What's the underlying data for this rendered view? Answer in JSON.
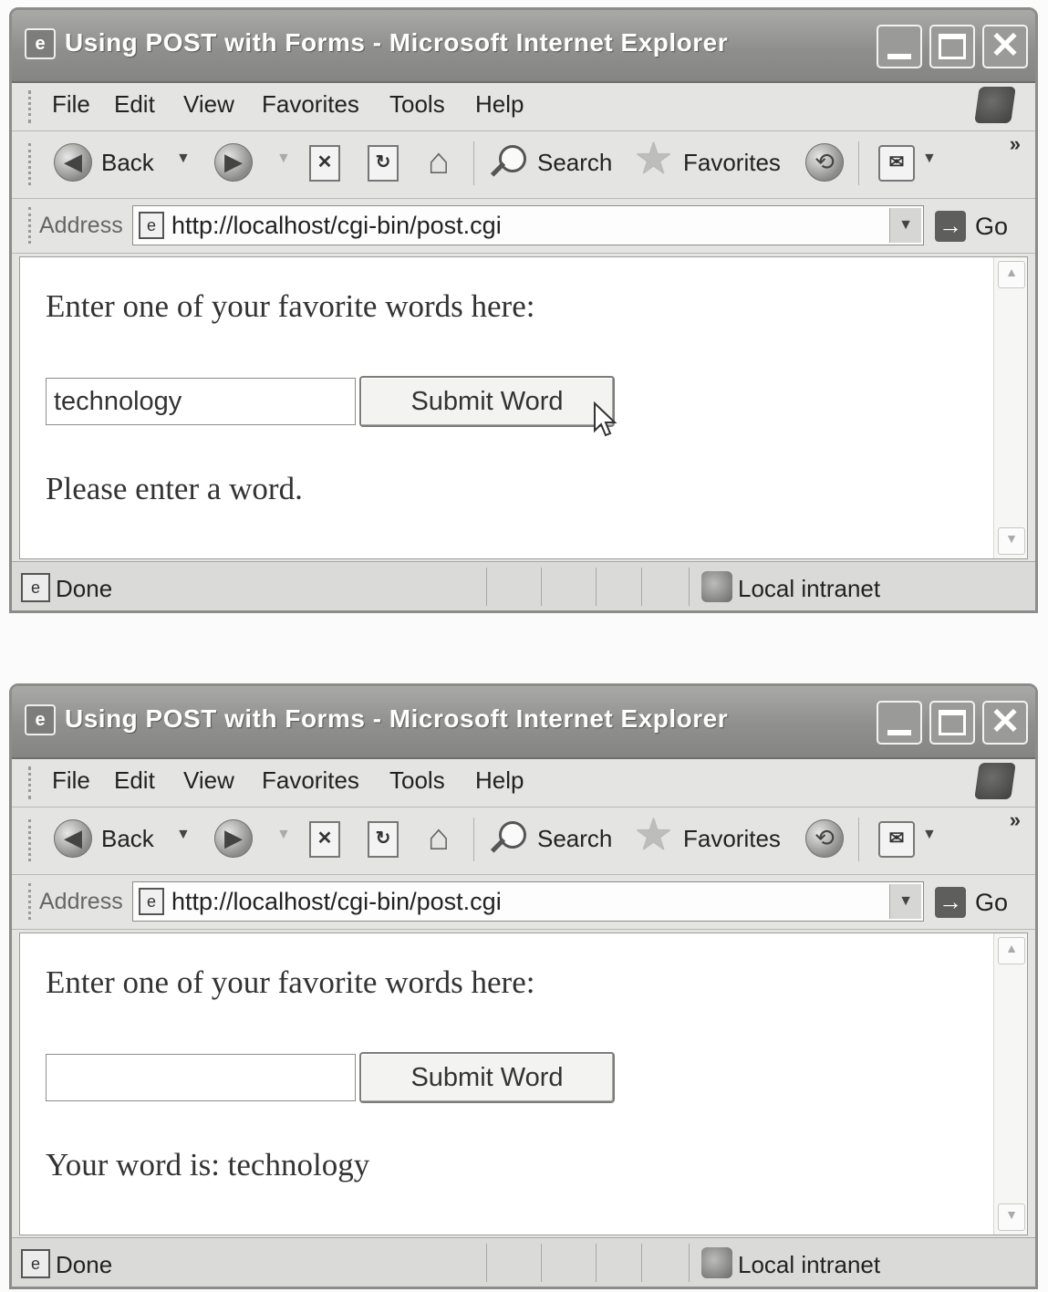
{
  "windows": [
    {
      "title": "Using POST with Forms - Microsoft Internet Explorer",
      "menu": [
        "File",
        "Edit",
        "View",
        "Favorites",
        "Tools",
        "Help"
      ],
      "toolbar": {
        "back": "Back",
        "search": "Search",
        "favorites": "Favorites",
        "more": "»"
      },
      "address": {
        "label": "Address",
        "url": "http://localhost/cgi-bin/post.cgi",
        "go": "Go"
      },
      "page": {
        "prompt": "Enter one of your favorite words here:",
        "input_value": "technology",
        "submit_label": "Submit Word",
        "result": "Please enter a word."
      },
      "status": {
        "text": "Done",
        "zone": "Local intranet"
      },
      "cursor_visible": true
    },
    {
      "title": "Using POST with Forms - Microsoft Internet Explorer",
      "menu": [
        "File",
        "Edit",
        "View",
        "Favorites",
        "Tools",
        "Help"
      ],
      "toolbar": {
        "back": "Back",
        "search": "Search",
        "favorites": "Favorites",
        "more": "»"
      },
      "address": {
        "label": "Address",
        "url": "http://localhost/cgi-bin/post.cgi",
        "go": "Go"
      },
      "page": {
        "prompt": "Enter one of your favorite words here:",
        "input_value": "",
        "submit_label": "Submit Word",
        "result": "Your word is: technology"
      },
      "status": {
        "text": "Done",
        "zone": "Local intranet"
      },
      "cursor_visible": false
    }
  ],
  "colors": {
    "titlebar": "#8f8f8d",
    "chrome": "#e4e4e2",
    "content_bg": "#ffffff"
  },
  "icons": [
    "ie-app-icon",
    "minimize-icon",
    "maximize-icon",
    "close-icon",
    "windows-xp-logo-icon",
    "back-icon",
    "forward-icon",
    "stop-icon",
    "refresh-icon",
    "home-icon",
    "search-icon",
    "favorites-star-icon",
    "history-icon",
    "mail-icon",
    "page-icon",
    "go-icon",
    "local-intranet-icon",
    "mouse-cursor-icon"
  ]
}
